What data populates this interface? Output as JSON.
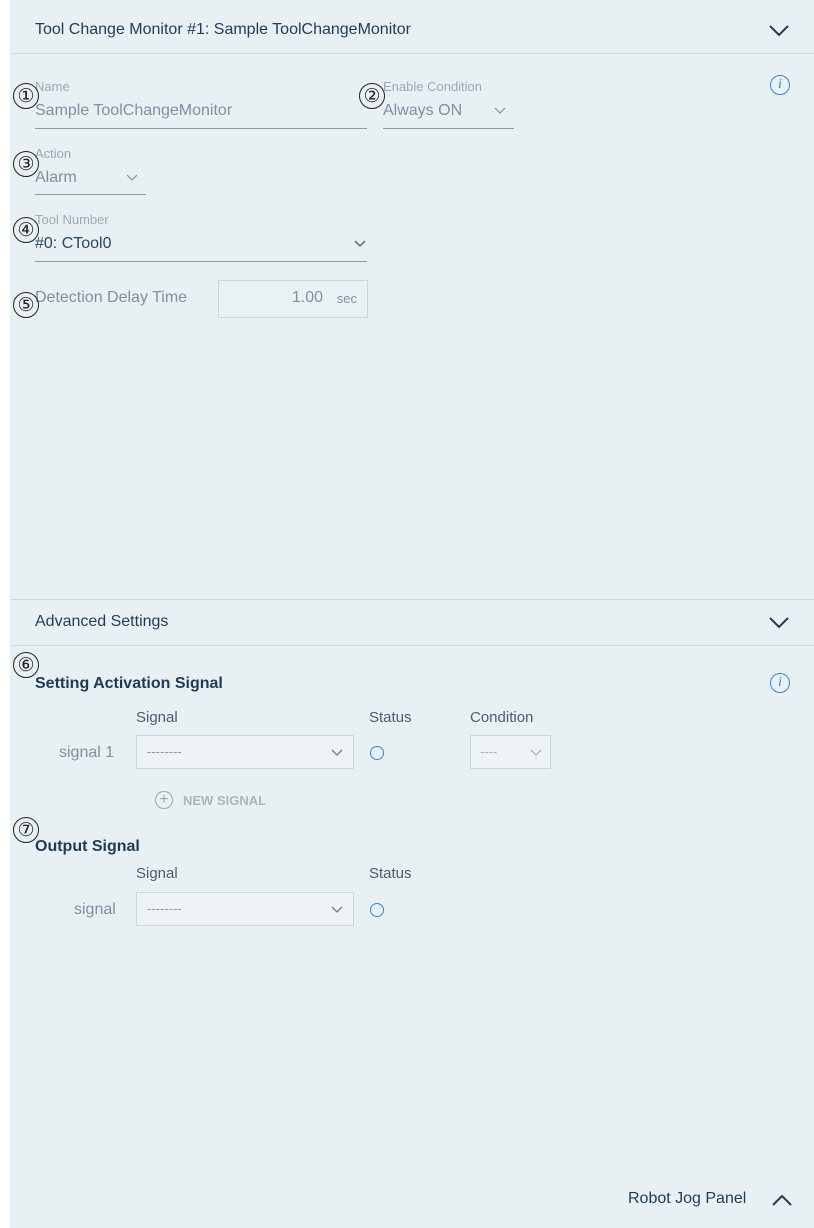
{
  "header": {
    "title": "Tool Change Monitor #1: Sample ToolChangeMonitor"
  },
  "fields": {
    "name": {
      "label": "Name",
      "value": "Sample ToolChangeMonitor"
    },
    "enable_condition": {
      "label": "Enable Condition",
      "value": "Always ON"
    },
    "action": {
      "label": "Action",
      "value": "Alarm"
    },
    "tool_number": {
      "label": "Tool Number",
      "value": "#0: CTool0"
    },
    "detection_delay": {
      "label": "Detection Delay Time",
      "value": "1.00",
      "unit": "sec"
    }
  },
  "advanced": {
    "title": "Advanced Settings"
  },
  "activation": {
    "title": "Setting Activation Signal",
    "col_signal": "Signal",
    "col_status": "Status",
    "col_condition": "Condition",
    "row_label": "signal 1",
    "signal_value": "--------",
    "condition_value": "----",
    "new_signal": "NEW SIGNAL"
  },
  "output": {
    "title": "Output Signal",
    "col_signal": "Signal",
    "col_status": "Status",
    "row_label": "signal",
    "signal_value": "--------"
  },
  "footer": {
    "jog_panel": "Robot Jog Panel"
  },
  "markers": [
    "①",
    "②",
    "③",
    "④",
    "⑤",
    "⑥",
    "⑦"
  ],
  "icons": {
    "info": "i",
    "plus": "+"
  },
  "colors": {
    "panel_bg": "#e8f0f4",
    "accent": "#3a86d0",
    "text_dark": "#1f3b57",
    "text_muted": "#9aa9b5"
  }
}
